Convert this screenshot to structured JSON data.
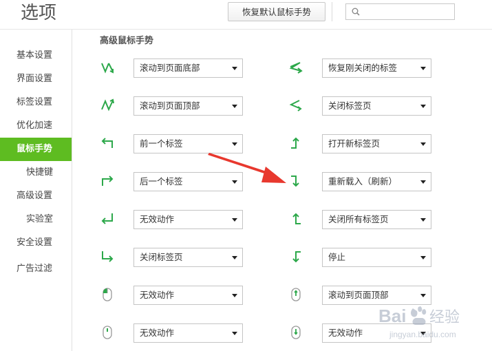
{
  "header": {
    "title": "选项",
    "reset_button": "恢复默认鼠标手势",
    "search_placeholder": ""
  },
  "sidebar": {
    "items": [
      {
        "label": "基本设置"
      },
      {
        "label": "界面设置"
      },
      {
        "label": "标签设置"
      },
      {
        "label": "优化加速"
      },
      {
        "label": "鼠标手势",
        "active": true
      },
      {
        "label": "快捷键"
      },
      {
        "label": "高级设置"
      },
      {
        "label": "实验室"
      },
      {
        "label": "安全设置"
      },
      {
        "label": "广告过滤"
      }
    ]
  },
  "main": {
    "section_title": "高级鼠标手势",
    "left": [
      {
        "icon": "down-up-gesture-icon",
        "value": "滚动到页面底部"
      },
      {
        "icon": "up-down-gesture-icon",
        "value": "滚动到页面顶部"
      },
      {
        "icon": "left-arrow-gesture-icon",
        "value": "前一个标签"
      },
      {
        "icon": "right-arrow-gesture-icon",
        "value": "后一个标签"
      },
      {
        "icon": "return-left-gesture-icon",
        "value": "无效动作"
      },
      {
        "icon": "down-right-gesture-icon",
        "value": "关闭标签页"
      },
      {
        "icon": "mouse-left-button-icon",
        "value": "无效动作"
      },
      {
        "icon": "mouse-wheel-icon",
        "value": "无效动作"
      }
    ],
    "right": [
      {
        "icon": "right-left-gesture-icon",
        "value": "恢复刚关闭的标签"
      },
      {
        "icon": "left-right-gesture-icon",
        "value": "关闭标签页"
      },
      {
        "icon": "up-right-gesture-icon",
        "value": "打开新标签页"
      },
      {
        "icon": "right-down-gesture-icon",
        "value": "重新载入（刷新）"
      },
      {
        "icon": "up-left-gesture-icon",
        "value": "关闭所有标签页"
      },
      {
        "icon": "down-left-gesture-icon",
        "value": "停止"
      },
      {
        "icon": "mouse-wheel-up-icon",
        "value": "滚动到页面顶部"
      },
      {
        "icon": "mouse-wheel-down-icon",
        "value": "无效动作"
      }
    ]
  },
  "watermark": {
    "text": "Bai 经验",
    "url": "jingyan.baidu.com"
  },
  "colors": {
    "accent": "#5ebc21",
    "icon_green": "#2ca84a",
    "annotation_red": "#e8382e"
  }
}
